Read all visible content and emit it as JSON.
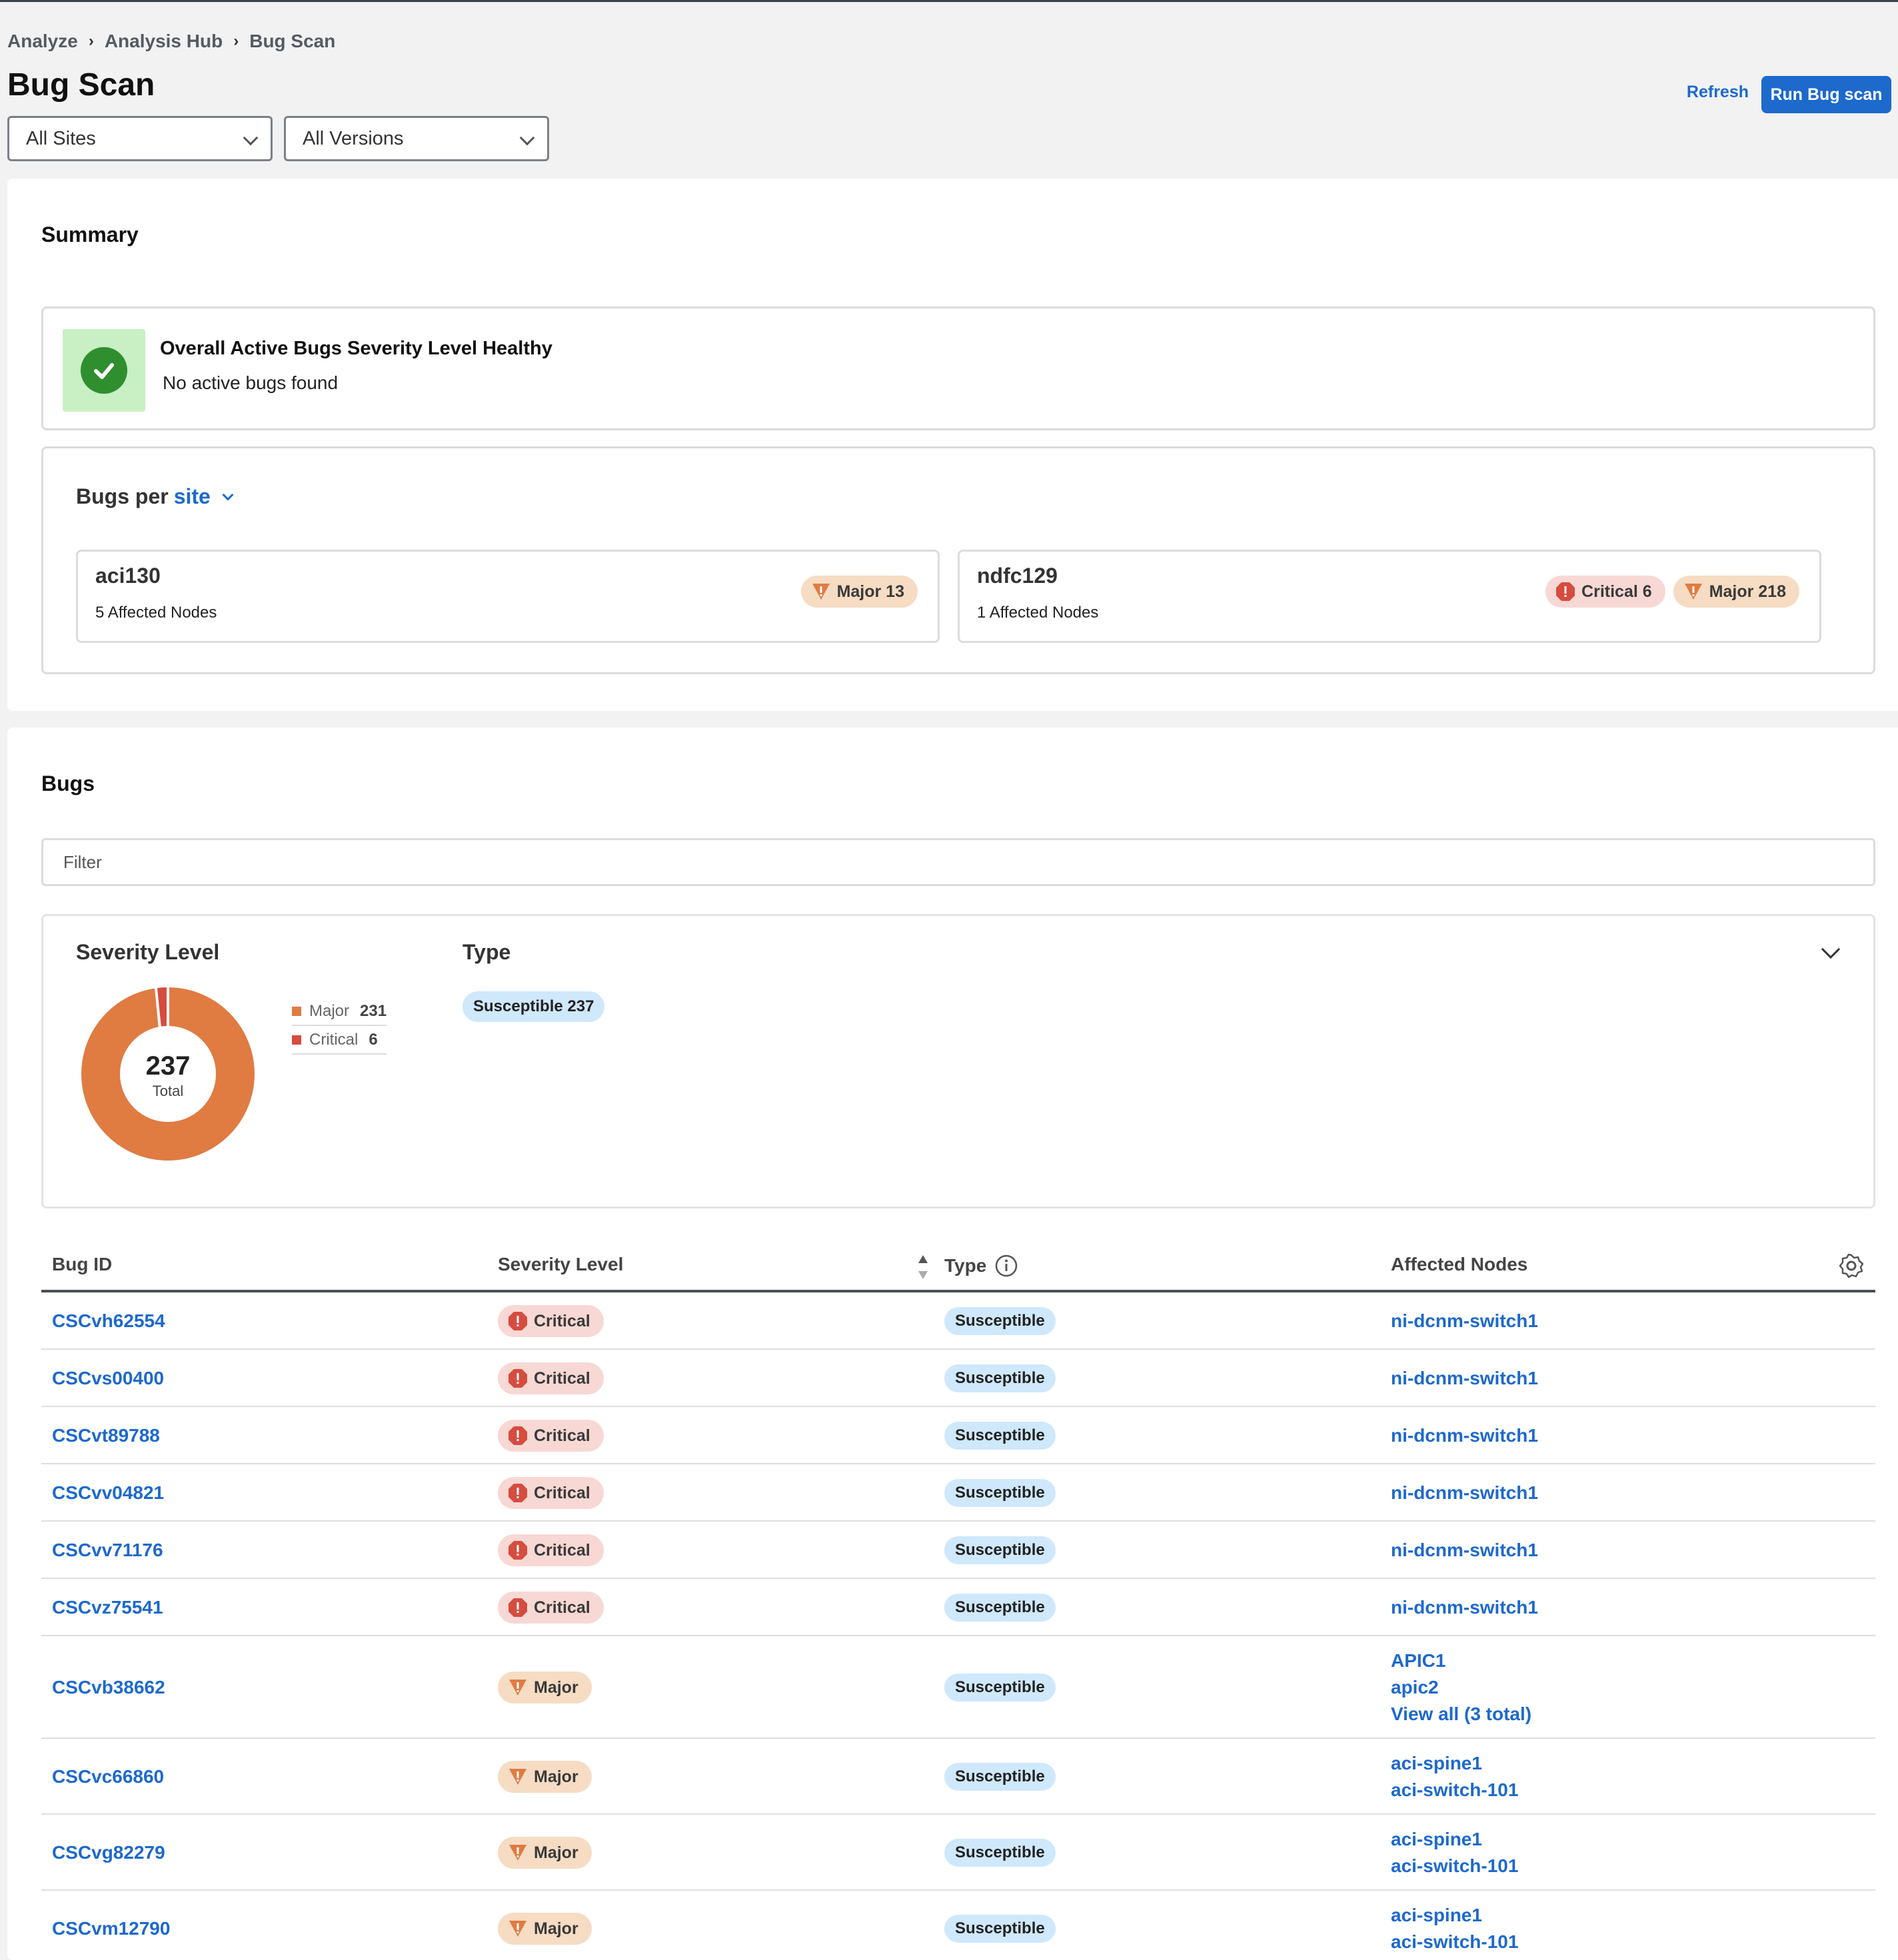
{
  "breadcrumb": [
    "Analyze",
    "Analysis Hub",
    "Bug Scan"
  ],
  "page_title": "Bug Scan",
  "filters": {
    "site": "All Sites",
    "version": "All Versions"
  },
  "actions": {
    "refresh": "Refresh",
    "run": "Run Bug scan"
  },
  "summary": {
    "title": "Summary",
    "health_title": "Overall Active Bugs Severity Level Healthy",
    "health_sub": "No active bugs found",
    "bps_prefix": "Bugs per",
    "bps_link": "site",
    "sites": [
      {
        "name": "aci130",
        "nodes": "5 Affected Nodes",
        "badges": [
          {
            "kind": "major",
            "label": "Major 13"
          }
        ]
      },
      {
        "name": "ndfc129",
        "nodes": "1 Affected Nodes",
        "badges": [
          {
            "kind": "critical",
            "label": "Critical 6"
          },
          {
            "kind": "major",
            "label": "Major 218"
          }
        ]
      }
    ]
  },
  "bugs": {
    "title": "Bugs",
    "filter_placeholder": "Filter",
    "severity_title": "Severity Level",
    "type_title": "Type",
    "type_pill": "Susceptible 237",
    "donut_total": "237",
    "donut_total_label": "Total",
    "legend": [
      {
        "name": "Major",
        "value": "231"
      },
      {
        "name": "Critical",
        "value": "6"
      }
    ],
    "colors": {
      "major": "#e07b42",
      "critical": "#d64c3f",
      "link": "#1d69cc"
    },
    "columns": {
      "id": "Bug ID",
      "severity": "Severity Level",
      "type": "Type",
      "nodes": "Affected Nodes"
    },
    "rows": [
      {
        "id": "CSCvh62554",
        "severity": "Critical",
        "kind": "critical",
        "type": "Susceptible",
        "nodes": [
          "ni-dcnm-switch1"
        ]
      },
      {
        "id": "CSCvs00400",
        "severity": "Critical",
        "kind": "critical",
        "type": "Susceptible",
        "nodes": [
          "ni-dcnm-switch1"
        ]
      },
      {
        "id": "CSCvt89788",
        "severity": "Critical",
        "kind": "critical",
        "type": "Susceptible",
        "nodes": [
          "ni-dcnm-switch1"
        ]
      },
      {
        "id": "CSCvv04821",
        "severity": "Critical",
        "kind": "critical",
        "type": "Susceptible",
        "nodes": [
          "ni-dcnm-switch1"
        ]
      },
      {
        "id": "CSCvv71176",
        "severity": "Critical",
        "kind": "critical",
        "type": "Susceptible",
        "nodes": [
          "ni-dcnm-switch1"
        ]
      },
      {
        "id": "CSCvz75541",
        "severity": "Critical",
        "kind": "critical",
        "type": "Susceptible",
        "nodes": [
          "ni-dcnm-switch1"
        ]
      },
      {
        "id": "CSCvb38662",
        "severity": "Major",
        "kind": "major",
        "type": "Susceptible",
        "nodes": [
          "APIC1",
          "apic2",
          "View all (3 total)"
        ]
      },
      {
        "id": "CSCvc66860",
        "severity": "Major",
        "kind": "major",
        "type": "Susceptible",
        "nodes": [
          "aci-spine1",
          "aci-switch-101"
        ]
      },
      {
        "id": "CSCvg82279",
        "severity": "Major",
        "kind": "major",
        "type": "Susceptible",
        "nodes": [
          "aci-spine1",
          "aci-switch-101"
        ]
      },
      {
        "id": "CSCvm12790",
        "severity": "Major",
        "kind": "major",
        "type": "Susceptible",
        "nodes": [
          "aci-spine1",
          "aci-switch-101"
        ]
      }
    ]
  }
}
